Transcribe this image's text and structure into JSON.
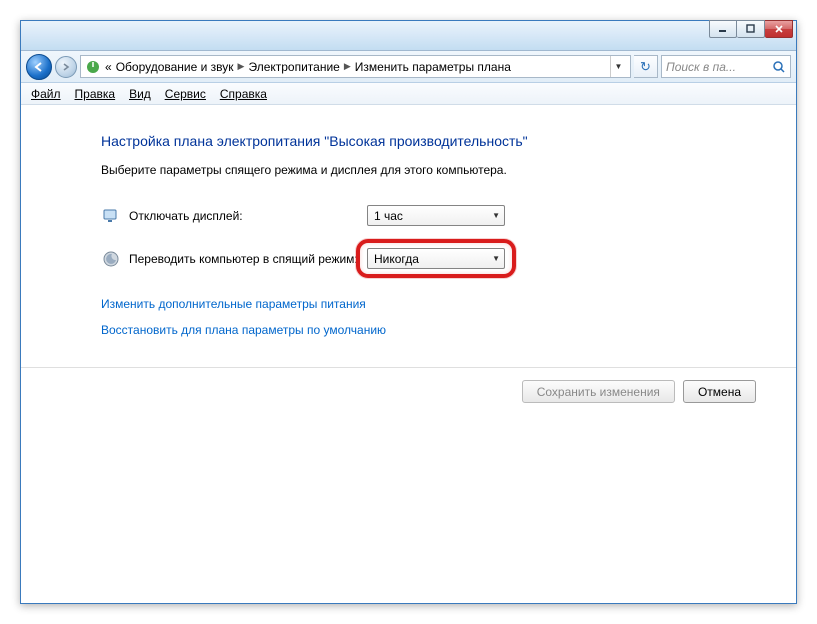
{
  "titlebar": {
    "min_icon": "minimize-icon",
    "max_icon": "maximize-icon",
    "close_icon": "close-icon"
  },
  "breadcrumb": {
    "prefix": "«",
    "items": [
      "Оборудование и звук",
      "Электропитание",
      "Изменить параметры плана"
    ]
  },
  "search": {
    "placeholder": "Поиск в па..."
  },
  "menu": {
    "file": "Файл",
    "edit": "Правка",
    "view": "Вид",
    "tools": "Сервис",
    "help": "Справка"
  },
  "page": {
    "title": "Настройка плана электропитания \"Высокая производительность\"",
    "subtitle": "Выберите параметры спящего режима и дисплея для этого компьютера."
  },
  "settings": {
    "display_off_label": "Отключать дисплей:",
    "display_off_value": "1 час",
    "sleep_label": "Переводить компьютер в спящий режим:",
    "sleep_value": "Никогда"
  },
  "links": {
    "advanced": "Изменить дополнительные параметры питания",
    "restore": "Восстановить для плана параметры по умолчанию"
  },
  "buttons": {
    "save": "Сохранить изменения",
    "cancel": "Отмена"
  }
}
